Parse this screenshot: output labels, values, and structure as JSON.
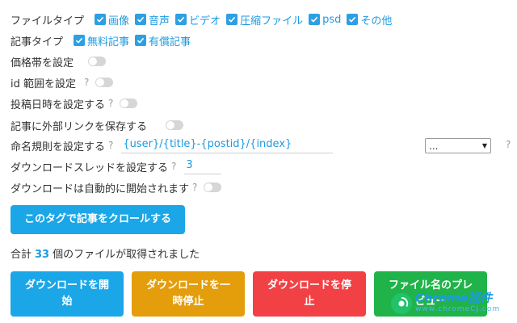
{
  "file_types": {
    "label": "ファイルタイプ",
    "options": [
      "画像",
      "音声",
      "ビデオ",
      "圧縮ファイル",
      "psd",
      "その他"
    ]
  },
  "article_types": {
    "label": "記事タイプ",
    "options": [
      "無料記事",
      "有償記事"
    ]
  },
  "settings": {
    "price_range": "価格帯を設定",
    "id_range": "id 範囲を設定",
    "post_date": "投稿日時を設定する",
    "save_links": "記事に外部リンクを保存する",
    "naming_rule": "命名規則を設定する",
    "download_threads": "ダウンロードスレッドを設定する",
    "auto_start": "ダウンロードは自動的に開始されます",
    "help_mark": "?"
  },
  "naming_rule_value": "{user}/{title}-{postid}/{index}",
  "naming_select_value": "...",
  "thread_count": "3",
  "crawl_button": "このタグで記事をクロールする",
  "total": {
    "prefix": "合計",
    "count": "33",
    "suffix": "個のファイルが取得されました"
  },
  "buttons": {
    "start_line1": "ダウンロードを開",
    "start_line2": "始",
    "pause_line1": "ダウンロードを一",
    "pause_line2": "時停止",
    "stop_line1": "ダウンロードを停",
    "stop_line2": "止",
    "preview_line1": "ファイル名のプレ",
    "preview_line2": "ビュー"
  },
  "watermark": {
    "title": "Chrome插件",
    "url": "www.chromeCJ.com"
  },
  "colors": {
    "accent": "#1e9ae0",
    "checkbox": "#2d9fe3",
    "button_blue": "#1ba6e8",
    "button_orange": "#e49d0b",
    "button_red": "#f24145",
    "button_green": "#20b34a"
  }
}
